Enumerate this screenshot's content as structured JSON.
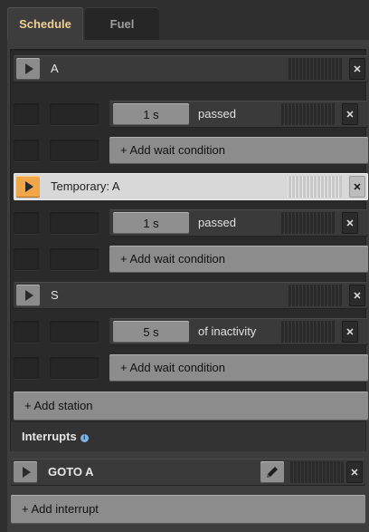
{
  "tabs": [
    {
      "label": "Schedule",
      "active": true
    },
    {
      "label": "Fuel",
      "active": false
    }
  ],
  "schedule": {
    "stations": [
      {
        "name": "A",
        "temporary": false,
        "conditions": [
          {
            "value": "1 s",
            "label": "passed"
          }
        ],
        "add_wait_label": "+ Add wait condition"
      },
      {
        "name": "Temporary: A",
        "temporary": true,
        "conditions": [
          {
            "value": "1 s",
            "label": "passed"
          }
        ],
        "add_wait_label": "+ Add wait condition"
      },
      {
        "name": "S",
        "temporary": false,
        "conditions": [
          {
            "value": "5 s",
            "label": "of inactivity"
          }
        ],
        "add_wait_label": "+ Add wait condition"
      }
    ],
    "add_station_label": "+ Add station"
  },
  "interrupts": {
    "title": "Interrupts",
    "info_icon": "info-icon",
    "items": [
      {
        "name": "GOTO A"
      }
    ],
    "add_interrupt_label": "+ Add interrupt"
  },
  "icons": {
    "play": "play-icon",
    "close": "close-icon",
    "edit": "pencil-icon",
    "grip": "drag-handle-icon"
  },
  "colors": {
    "accent_tab_text": "#f0cf96",
    "temporary_play": "#f2a64a",
    "button_grey": "#8c8c8c"
  }
}
